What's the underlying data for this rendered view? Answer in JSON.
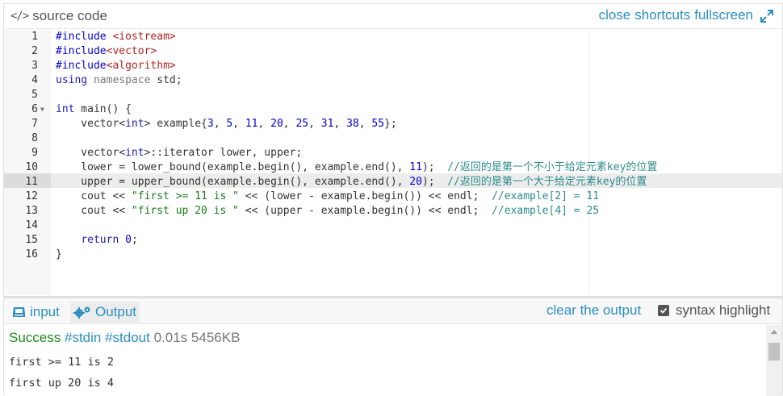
{
  "header": {
    "title": "source code",
    "links": [
      "close",
      "shortcuts",
      "fullscreen"
    ]
  },
  "editor": {
    "active_line": 11,
    "lines": [
      {
        "n": "1",
        "segments": [
          {
            "t": "#include ",
            "c": "pp"
          },
          {
            "t": "<iostream>",
            "c": "inc"
          }
        ]
      },
      {
        "n": "2",
        "segments": [
          {
            "t": "#include",
            "c": "pp"
          },
          {
            "t": "<vector>",
            "c": "inc"
          }
        ]
      },
      {
        "n": "3",
        "segments": [
          {
            "t": "#include",
            "c": "pp"
          },
          {
            "t": "<algorithm>",
            "c": "inc"
          }
        ]
      },
      {
        "n": "4",
        "segments": [
          {
            "t": "using",
            "c": "kw"
          },
          {
            "t": " ",
            "c": ""
          },
          {
            "t": "namespace",
            "c": "kwp"
          },
          {
            "t": " std;",
            "c": ""
          }
        ]
      },
      {
        "n": "5",
        "segments": []
      },
      {
        "n": "6",
        "fold": true,
        "segments": [
          {
            "t": "int",
            "c": "kw"
          },
          {
            "t": " main() {",
            "c": ""
          }
        ]
      },
      {
        "n": "7",
        "segments": [
          {
            "t": "    vector<",
            "c": ""
          },
          {
            "t": "int",
            "c": "kw"
          },
          {
            "t": "> example{",
            "c": ""
          },
          {
            "t": "3",
            "c": "num"
          },
          {
            "t": ", ",
            "c": ""
          },
          {
            "t": "5",
            "c": "num"
          },
          {
            "t": ", ",
            "c": ""
          },
          {
            "t": "11",
            "c": "num"
          },
          {
            "t": ", ",
            "c": ""
          },
          {
            "t": "20",
            "c": "num"
          },
          {
            "t": ", ",
            "c": ""
          },
          {
            "t": "25",
            "c": "num"
          },
          {
            "t": ", ",
            "c": ""
          },
          {
            "t": "31",
            "c": "num"
          },
          {
            "t": ", ",
            "c": ""
          },
          {
            "t": "38",
            "c": "num"
          },
          {
            "t": ", ",
            "c": ""
          },
          {
            "t": "55",
            "c": "num"
          },
          {
            "t": "};",
            "c": ""
          }
        ]
      },
      {
        "n": "8",
        "segments": []
      },
      {
        "n": "9",
        "segments": [
          {
            "t": "    vector<",
            "c": ""
          },
          {
            "t": "int",
            "c": "kw"
          },
          {
            "t": ">::iterator lower, upper;",
            "c": ""
          }
        ]
      },
      {
        "n": "10",
        "segments": [
          {
            "t": "    lower = lower_bound(example.begin(), example.end(), ",
            "c": ""
          },
          {
            "t": "11",
            "c": "num"
          },
          {
            "t": ");  ",
            "c": ""
          },
          {
            "t": "//返回的是第一个不小于给定元素key的位置",
            "c": "cm"
          }
        ]
      },
      {
        "n": "11",
        "segments": [
          {
            "t": "    upper = upper_bound(example.begin(), example.end(), ",
            "c": ""
          },
          {
            "t": "20",
            "c": "num"
          },
          {
            "t": ");  ",
            "c": ""
          },
          {
            "t": "//返回的是第一个大于给定元素key的位置",
            "c": "cm"
          }
        ]
      },
      {
        "n": "12",
        "segments": [
          {
            "t": "    cout << ",
            "c": ""
          },
          {
            "t": "\"first >= 11 is \"",
            "c": "str"
          },
          {
            "t": " << (lower - example.begin()) << endl;  ",
            "c": ""
          },
          {
            "t": "//example[2] = 11",
            "c": "cm"
          }
        ]
      },
      {
        "n": "13",
        "segments": [
          {
            "t": "    cout << ",
            "c": ""
          },
          {
            "t": "\"first up 20 is \"",
            "c": "str"
          },
          {
            "t": " << (upper - example.begin()) << endl;  ",
            "c": ""
          },
          {
            "t": "//example[4] = 25",
            "c": "cm"
          }
        ]
      },
      {
        "n": "14",
        "segments": []
      },
      {
        "n": "15",
        "segments": [
          {
            "t": "    ",
            "c": ""
          },
          {
            "t": "return",
            "c": "kw"
          },
          {
            "t": " ",
            "c": ""
          },
          {
            "t": "0",
            "c": "num"
          },
          {
            "t": ";",
            "c": ""
          }
        ]
      },
      {
        "n": "16",
        "segments": [
          {
            "t": "}",
            "c": ""
          }
        ]
      }
    ]
  },
  "bottom": {
    "tab_input": "input",
    "tab_output": "Output",
    "clear": "clear the output",
    "syntax": "syntax highlight",
    "syntax_checked": true
  },
  "output": {
    "status": "Success",
    "stdin": "#stdin",
    "stdout": "#stdout",
    "time": "0.01s",
    "memory": "5456KB",
    "lines": [
      "first >= 11 is 2",
      "first up 20 is 4"
    ]
  },
  "colors": {
    "link": "#2a8fc1",
    "success": "#1b8a1b"
  },
  "icons": [
    "code-icon",
    "expand-icon",
    "keyboard-icon",
    "gears-icon",
    "checkbox-icon"
  ]
}
